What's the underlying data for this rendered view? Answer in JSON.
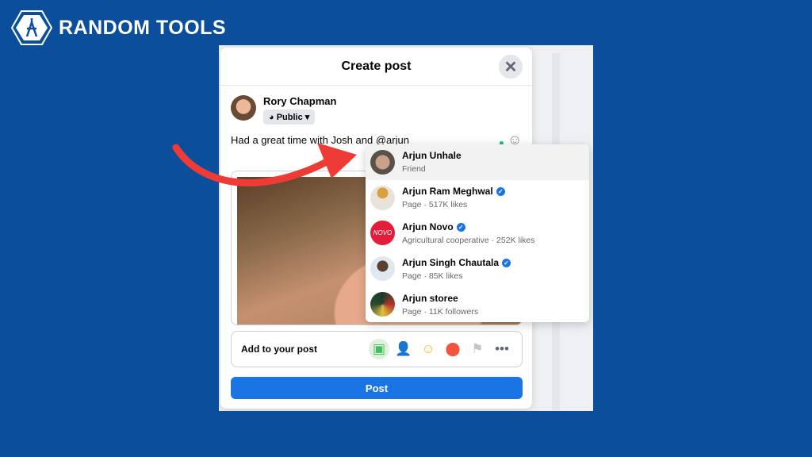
{
  "brand": {
    "name": "RANDOM TOOLS"
  },
  "modal": {
    "title": "Create post",
    "close_icon": "close-icon",
    "user": {
      "name": "Rory Chapman",
      "privacy": "Public"
    },
    "post_text": "Had a great time with Josh and @arjun",
    "add_to_post": "Add to your post",
    "add_icons": [
      "photo-video-icon",
      "tag-people-icon",
      "feeling-icon",
      "location-icon",
      "flag-icon",
      "more-icon"
    ],
    "post_button": "Post"
  },
  "mentions": [
    {
      "name": "Arjun Unhale",
      "sub": "Friend",
      "verified": false
    },
    {
      "name": "Arjun Ram Meghwal",
      "sub": "Page · 517K likes",
      "verified": true
    },
    {
      "name": "Arjun Novo",
      "sub": "Agricultural cooperative · 252K likes",
      "verified": true
    },
    {
      "name": "Arjun Singh Chautala",
      "sub": "Page · 85K likes",
      "verified": true
    },
    {
      "name": "Arjun storee",
      "sub": "Page · 11K followers",
      "verified": false
    }
  ],
  "colors": {
    "background": "#0a4e9c",
    "accent": "#1b74e4",
    "arrow": "#ee3b36"
  }
}
